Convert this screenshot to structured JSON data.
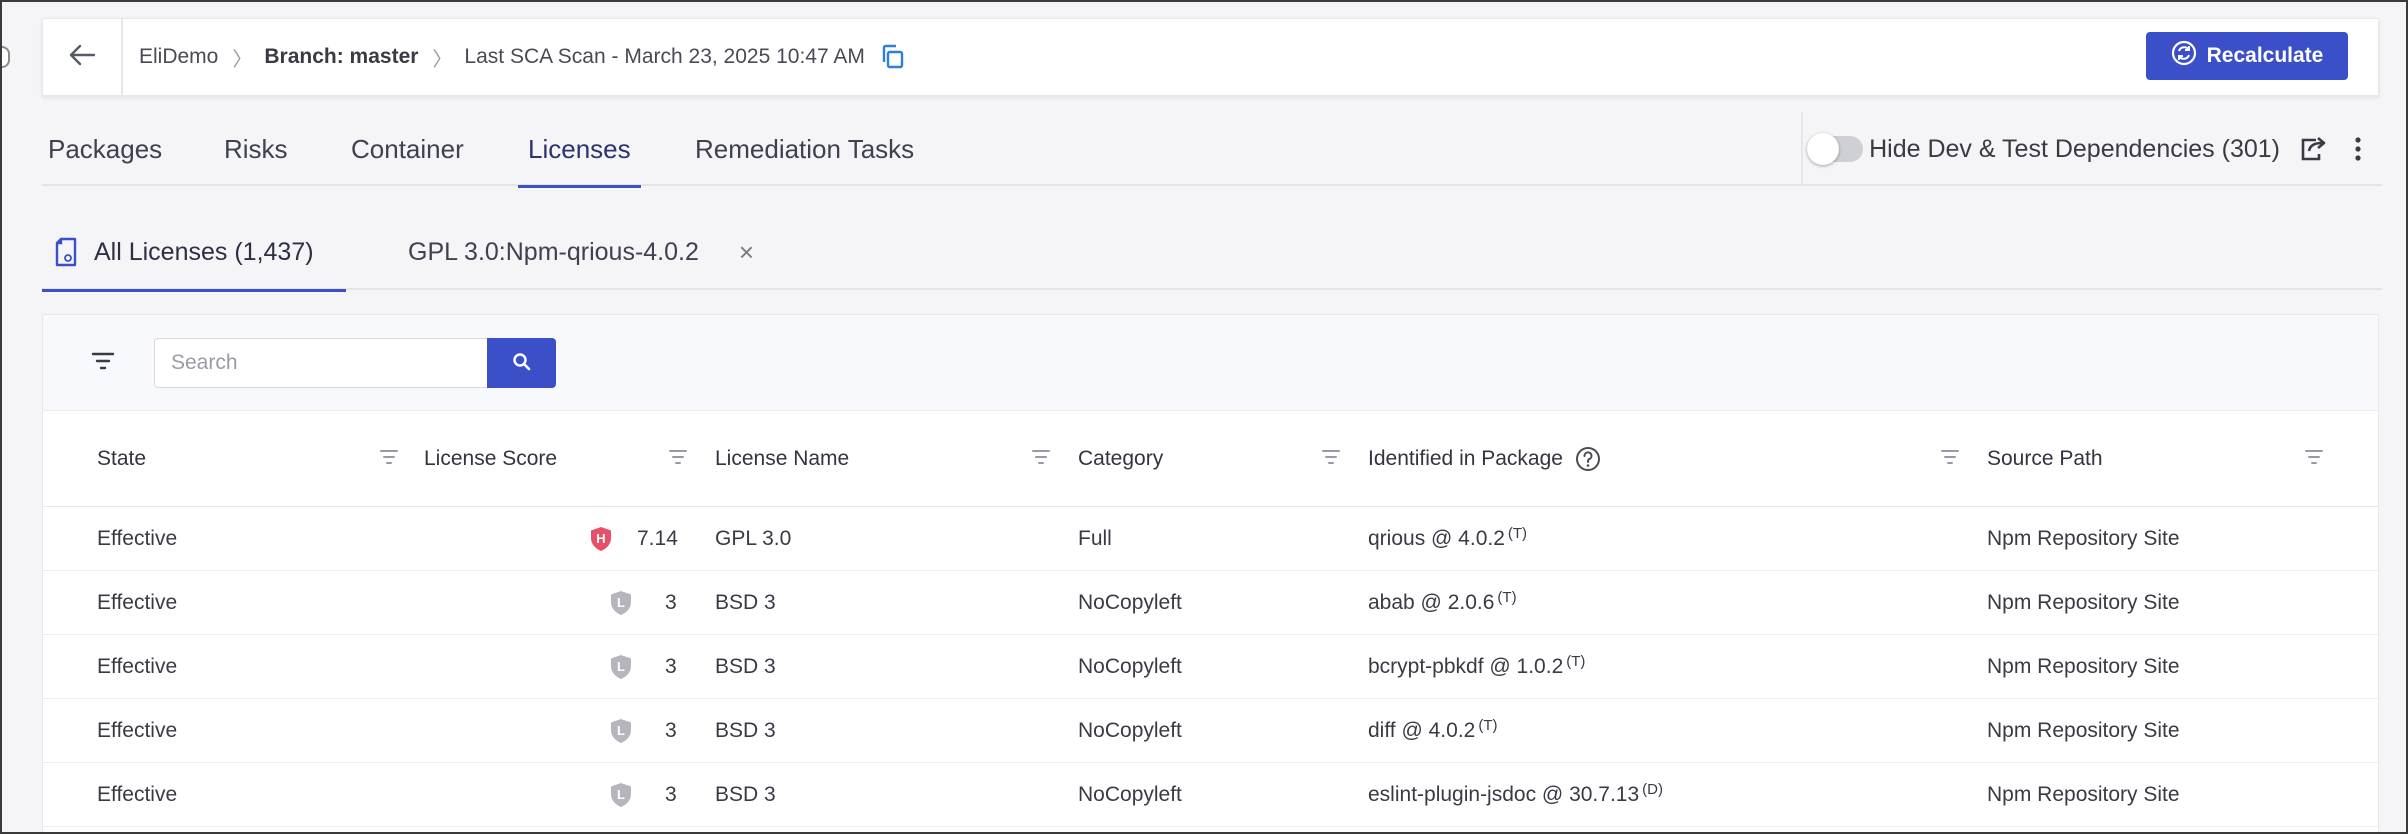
{
  "header": {
    "breadcrumb": {
      "project": "EliDemo",
      "branch": "Branch: master",
      "scan": "Last SCA Scan - March 23, 2025 10:47 AM"
    },
    "recalculate_label": "Recalculate"
  },
  "main_tabs": [
    "Packages",
    "Risks",
    "Container",
    "Licenses",
    "Remediation Tasks"
  ],
  "active_main_tab": "Licenses",
  "hide_dev_toggle": {
    "label": "Hide Dev & Test Dependencies (301)",
    "on": false
  },
  "sub_tabs": {
    "all": "All Licenses (1,437)",
    "detail": "GPL 3.0:Npm-qrious-4.0.2"
  },
  "search": {
    "placeholder": "Search"
  },
  "table": {
    "columns": [
      "State",
      "License Score",
      "License Name",
      "Category",
      "Identified in Package",
      "Source Path"
    ],
    "rows": [
      {
        "state": "Effective",
        "risk": "H",
        "score": "7.14",
        "license": "GPL 3.0",
        "category": "Full",
        "package": "qrious @ 4.0.2",
        "tag": "(T)",
        "source": "Npm Repository Site"
      },
      {
        "state": "Effective",
        "risk": "L",
        "score": "3",
        "license": "BSD 3",
        "category": "NoCopyleft",
        "package": "abab @ 2.0.6",
        "tag": "(T)",
        "source": "Npm Repository Site"
      },
      {
        "state": "Effective",
        "risk": "L",
        "score": "3",
        "license": "BSD 3",
        "category": "NoCopyleft",
        "package": "bcrypt-pbkdf @ 1.0.2",
        "tag": "(T)",
        "source": "Npm Repository Site"
      },
      {
        "state": "Effective",
        "risk": "L",
        "score": "3",
        "license": "BSD 3",
        "category": "NoCopyleft",
        "package": "diff @ 4.0.2",
        "tag": "(T)",
        "source": "Npm Repository Site"
      },
      {
        "state": "Effective",
        "risk": "L",
        "score": "3",
        "license": "BSD 3",
        "category": "NoCopyleft",
        "package": "eslint-plugin-jsdoc @ 30.7.13",
        "tag": "(D)",
        "source": "Npm Repository Site"
      }
    ]
  },
  "colors": {
    "accent": "#3b4fc8",
    "high_risk": "#e8506a",
    "low_risk": "#b5b5bd"
  },
  "icons": [
    "arrow-left-icon",
    "copy-icon",
    "recalculate-icon",
    "export-icon",
    "kebab-icon",
    "license-doc-icon",
    "close-icon",
    "filter-icon",
    "search-icon",
    "help-icon",
    "shield-icon"
  ]
}
